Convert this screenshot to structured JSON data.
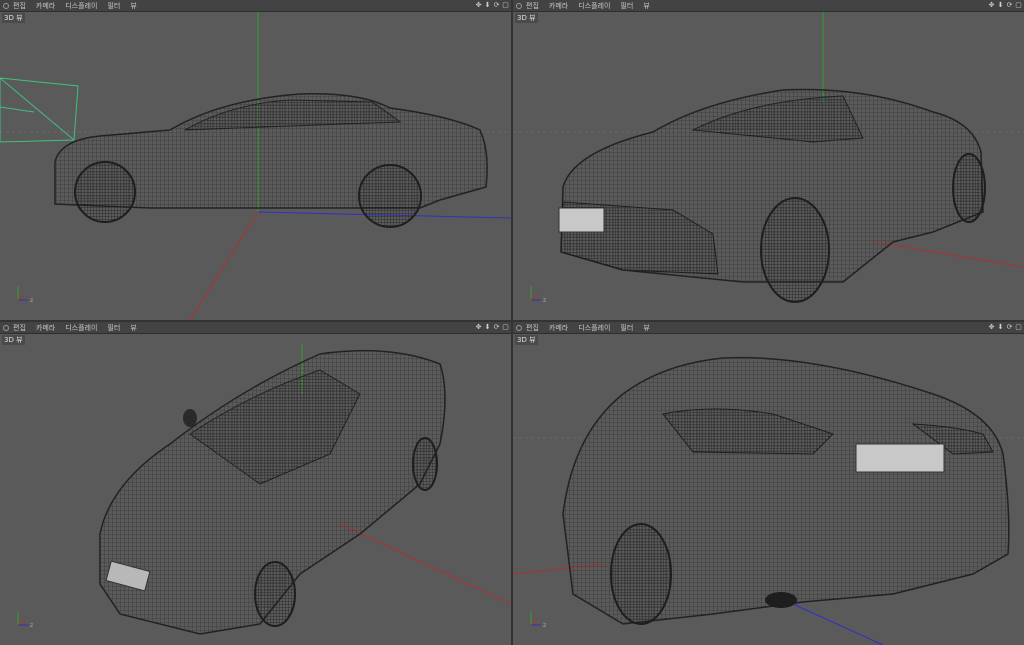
{
  "viewports": [
    {
      "menu": [
        "편집",
        "카메라",
        "디스플레이",
        "필터",
        "뷰"
      ],
      "label": "3D 뷰"
    },
    {
      "menu": [
        "편집",
        "카메라",
        "디스플레이",
        "필터",
        "뷰"
      ],
      "label": "3D 뷰"
    },
    {
      "menu": [
        "편집",
        "카메라",
        "디스플레이",
        "필터",
        "뷰"
      ],
      "label": "3D 뷰"
    },
    {
      "menu": [
        "편집",
        "카메라",
        "디스플레이",
        "필터",
        "뷰"
      ],
      "label": "3D 뷰"
    }
  ],
  "nav_icons": [
    "move-icon",
    "zoom-down-icon",
    "rotate-icon",
    "maximize-icon"
  ],
  "colors": {
    "viewport_bg": "#5a5a5a",
    "wireframe": "#2a2a2a",
    "axis_x": "#b03030",
    "axis_y": "#30a030",
    "axis_z": "#3030c0",
    "camera": "#40c080"
  },
  "axis_labels": {
    "x": "x",
    "y": "y",
    "z": "z"
  }
}
